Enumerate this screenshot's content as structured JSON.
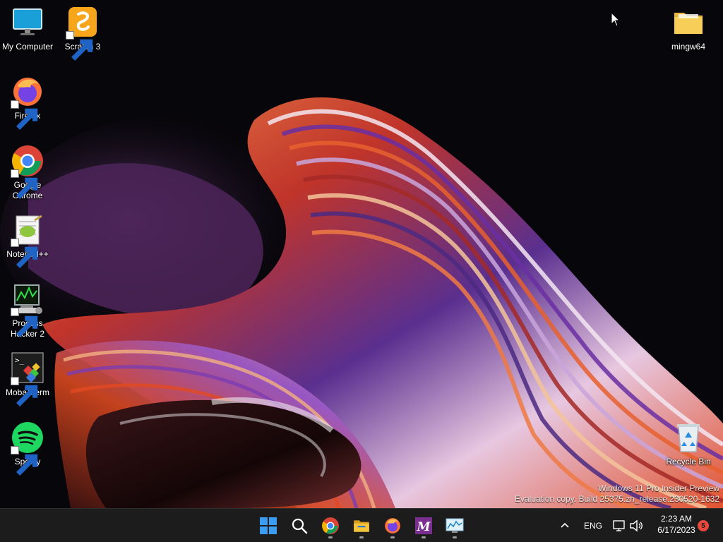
{
  "desktop_icons": [
    {
      "id": "my-computer",
      "label": "My Computer",
      "icon": "monitor-icon",
      "shortcut": false
    },
    {
      "id": "scratch",
      "label": "Scratch 3",
      "icon": "scratch-icon",
      "shortcut": true
    },
    {
      "id": "firefox",
      "label": "Firefox",
      "icon": "firefox-icon",
      "shortcut": true
    },
    {
      "id": "chrome",
      "label": "Google Chrome",
      "icon": "chrome-icon",
      "shortcut": true
    },
    {
      "id": "notepadpp",
      "label": "Notepad++",
      "icon": "notepadpp-icon",
      "shortcut": true
    },
    {
      "id": "process-hacker",
      "label": "Process Hacker 2",
      "icon": "process-hacker-icon",
      "shortcut": true
    },
    {
      "id": "mobaxterm",
      "label": "MobaXterm",
      "icon": "mobaxterm-icon",
      "shortcut": true
    },
    {
      "id": "spotify",
      "label": "Spotify",
      "icon": "spotify-icon",
      "shortcut": true
    },
    {
      "id": "mingw64",
      "label": "mingw64",
      "icon": "folder-icon",
      "shortcut": false
    },
    {
      "id": "recycle-bin",
      "label": "Recycle Bin",
      "icon": "recycle-bin-icon",
      "shortcut": false
    }
  ],
  "watermark": {
    "line1": "Windows 11 Pro Insider Preview",
    "line2": "Evaluation copy. Build 25375.zn_release.230520-1632"
  },
  "taskbar": {
    "pinned": [
      {
        "name": "start",
        "icon": "windows-start-icon",
        "running": false
      },
      {
        "name": "search",
        "icon": "search-icon",
        "running": false
      },
      {
        "name": "chrome",
        "icon": "chrome-icon",
        "running": true
      },
      {
        "name": "file-explorer",
        "icon": "file-explorer-icon",
        "running": true
      },
      {
        "name": "firefox",
        "icon": "firefox-icon",
        "running": true
      },
      {
        "name": "mobaxterm",
        "icon": "mobaxterm-icon",
        "running": true
      },
      {
        "name": "resource-monitor",
        "icon": "monitor-chart-icon",
        "running": true
      }
    ],
    "tray": {
      "overflow_icon": "chevron-up-icon",
      "language": "ENG",
      "network_icon": "network-icon",
      "volume_icon": "speaker-icon"
    },
    "clock": {
      "time": "2:23 AM",
      "date": "6/17/2023"
    },
    "notification_count": "5"
  },
  "colors": {
    "taskbar_bg": "#1c1c1c",
    "desktop_bg": "#07060a",
    "badge": "#e8483d",
    "windows_blue": "#3a9df2"
  }
}
